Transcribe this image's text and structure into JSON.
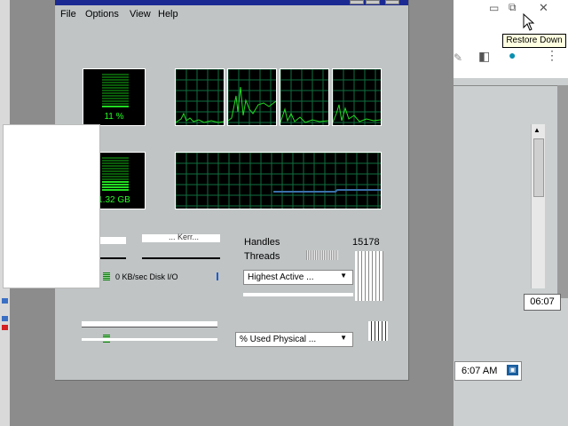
{
  "task_manager": {
    "menu": [
      "File",
      "Options",
      "View",
      "Help"
    ],
    "cpu_meter": {
      "value_text": "11 %",
      "level": 0.11
    },
    "memory_meter": {
      "value_text": "1.32 GB"
    },
    "cpu_graphs_count_label": "",
    "stats": {
      "handles_label": "Handles",
      "handles_value": "15178",
      "threads_label": "Threads",
      "disk_text": "0 KB/sec Disk I/O",
      "highest_active_dropdown": "Highest Active ...",
      "used_physical_dropdown": "% Used Physical ...",
      "partial_label": "... Kerr..."
    }
  },
  "background_window": {
    "restore_down_tooltip": "Restore Down",
    "time_field_1": "06:07",
    "time_field_2": "6:07 AM"
  },
  "colors": {
    "titlebar": "#1b2a93",
    "graph_bg": "#000000",
    "graph_line": "#22dd22",
    "grid": "#0f6f3f",
    "accent_icon": "#0a8fb0"
  }
}
